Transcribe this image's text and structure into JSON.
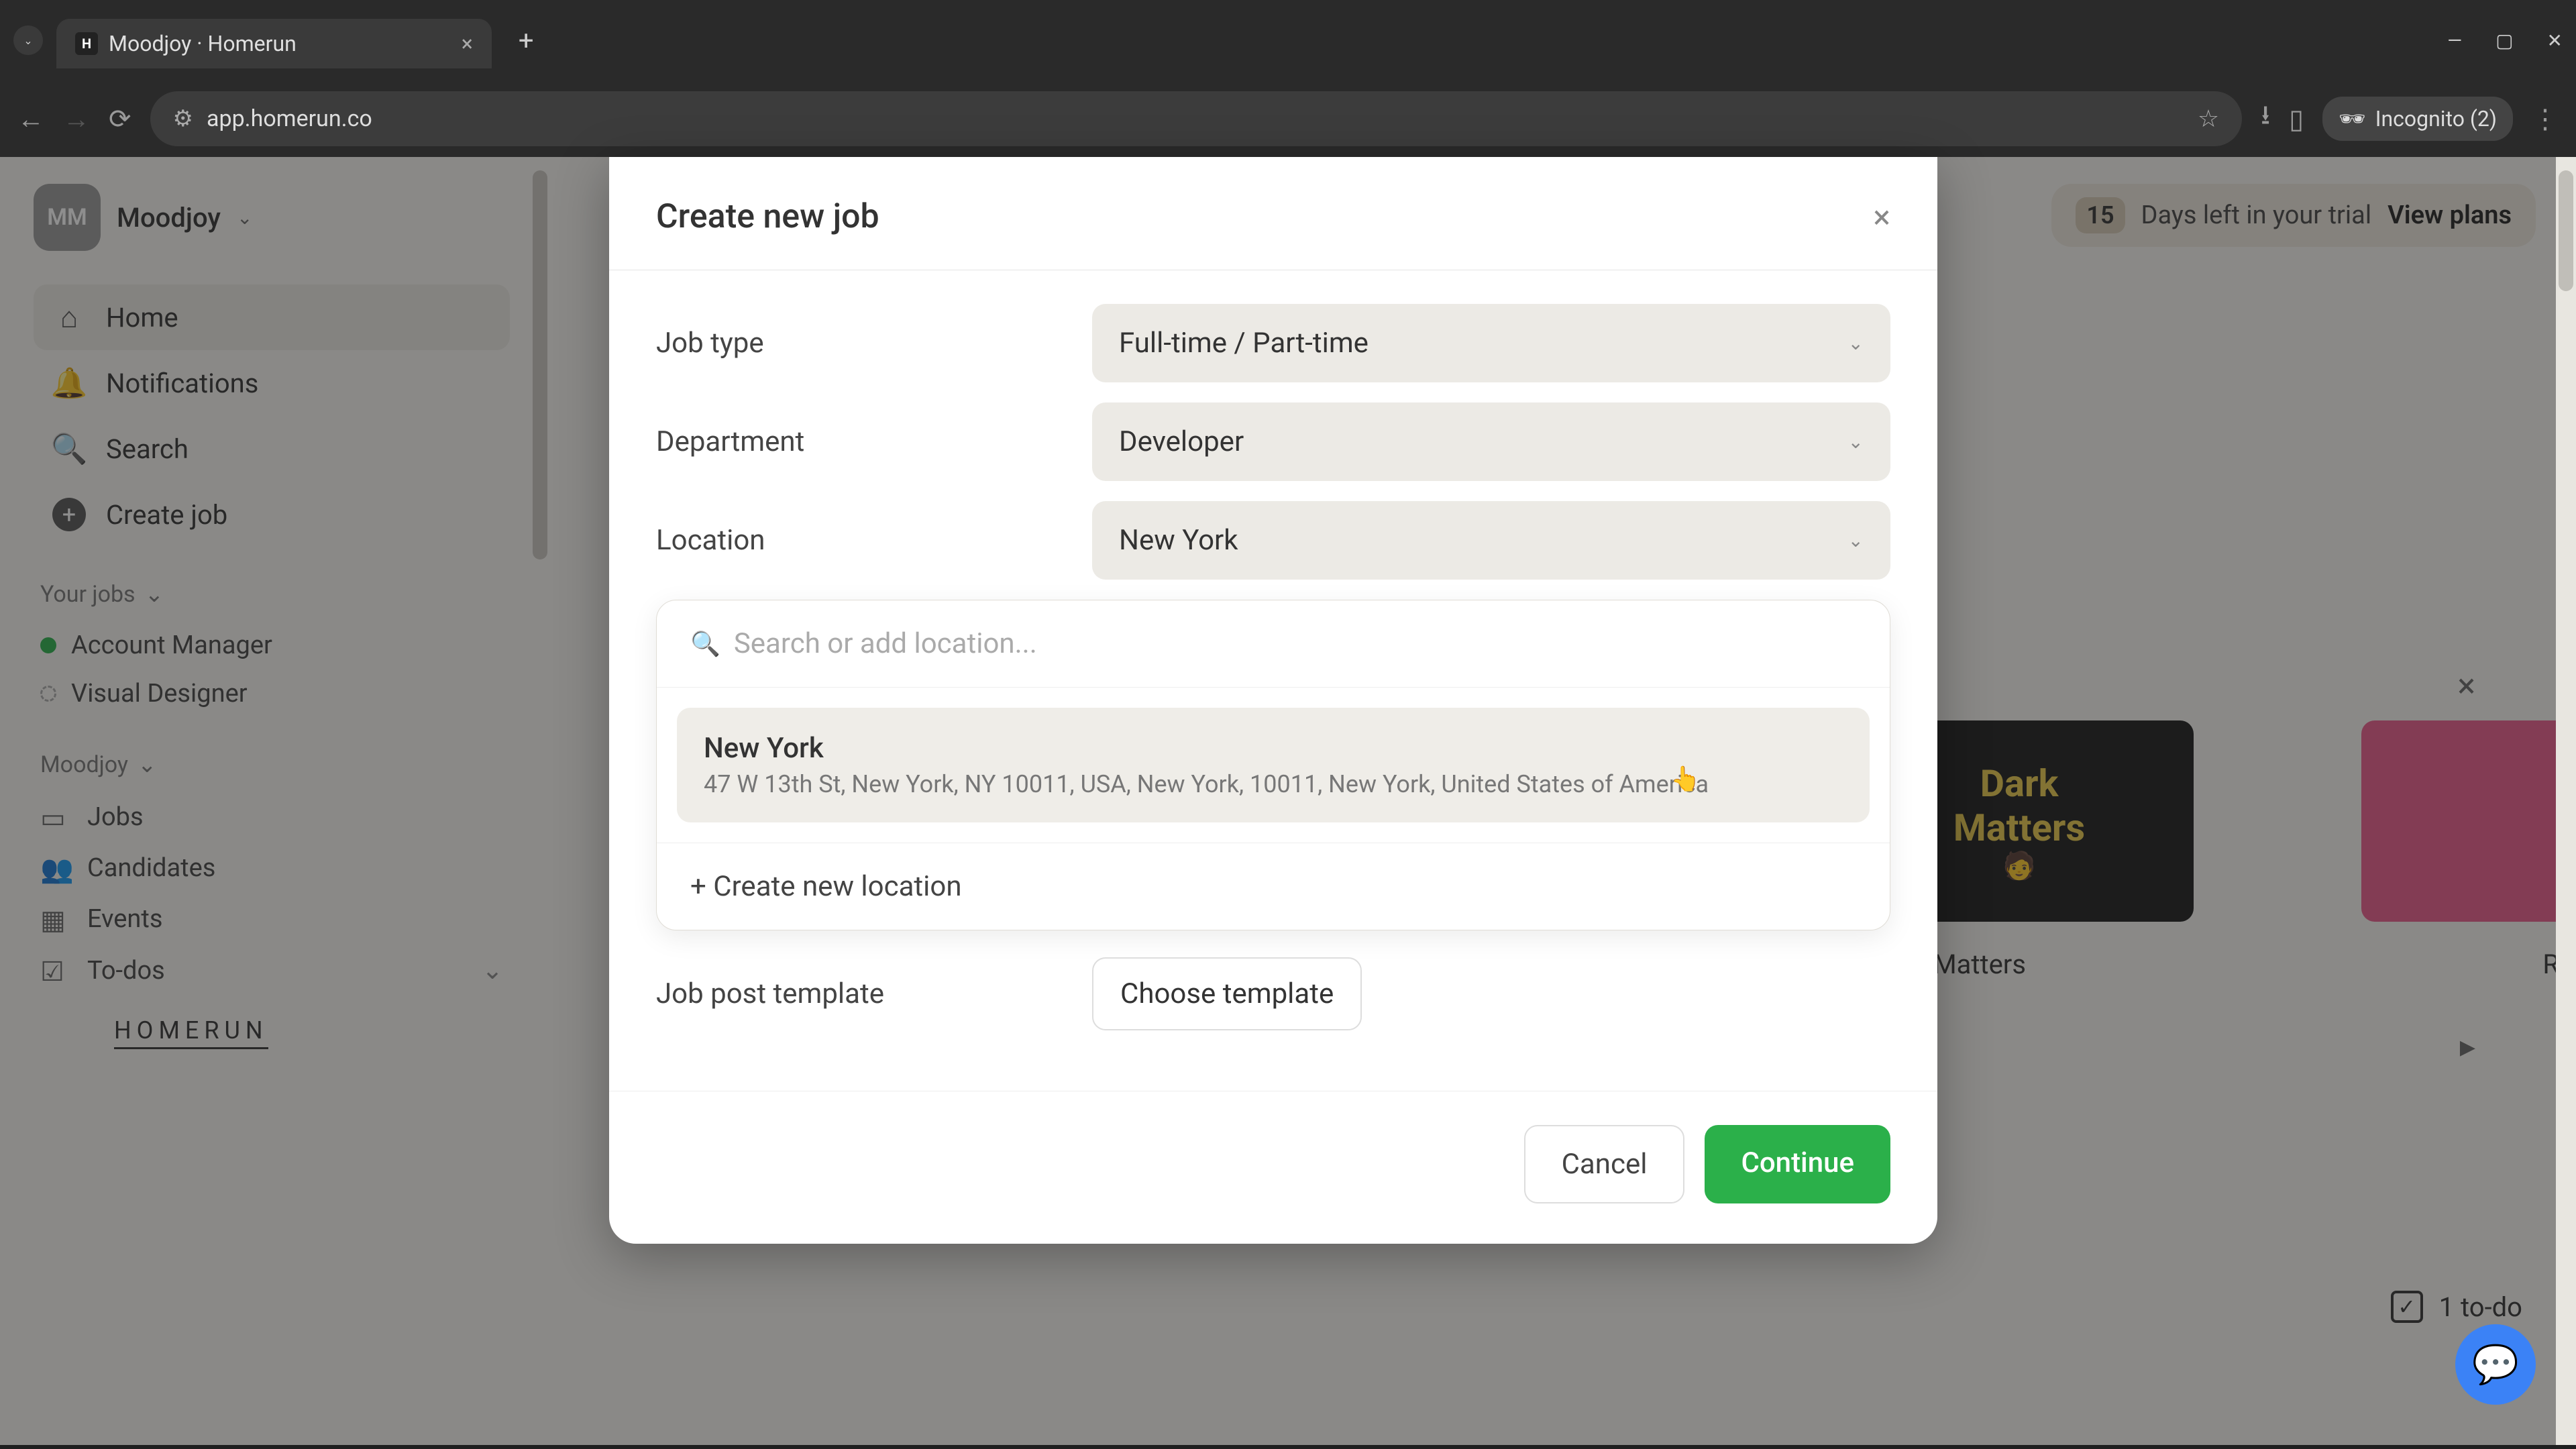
{
  "browser": {
    "tab_title": "Moodjoy · Homerun",
    "url": "app.homerun.co",
    "incognito_label": "Incognito (2)"
  },
  "workspace": {
    "avatar": "MM",
    "name": "Moodjoy"
  },
  "sidebar": {
    "nav": {
      "home": "Home",
      "notifications": "Notifications",
      "search": "Search",
      "create_job": "Create job"
    },
    "your_jobs_header": "Your jobs",
    "jobs": [
      {
        "label": "Account Manager",
        "status": "green"
      },
      {
        "label": "Visual Designer",
        "status": "gray"
      }
    ],
    "workspace_section": "Moodjoy",
    "bottom": {
      "jobs": "Jobs",
      "candidates": "Candidates",
      "events": "Events",
      "todos": "To-dos"
    },
    "logo": "HOMERUN"
  },
  "trial": {
    "days": "15",
    "text": "Days left in your trial",
    "cta": "View plans"
  },
  "cards": {
    "dark_matters": "Dark\nMatters",
    "dark_matters_label": "Dark Matters",
    "radic_label": "Radic"
  },
  "todo_widget": {
    "count_label": "1 to-do"
  },
  "modal": {
    "title": "Create new job",
    "job_type_label": "Job type",
    "job_type_value": "Full-time / Part-time",
    "department_label": "Department",
    "department_value": "Developer",
    "location_label": "Location",
    "location_value": "New York",
    "search_placeholder": "Search or add location...",
    "option_title": "New York",
    "option_sub": "47 W 13th St, New York, NY 10011, USA, New York, 10011, New York, United States of America",
    "create_location": "+ Create new location",
    "template_label": "Job post template",
    "template_btn": "Choose template",
    "cancel": "Cancel",
    "continue": "Continue"
  }
}
